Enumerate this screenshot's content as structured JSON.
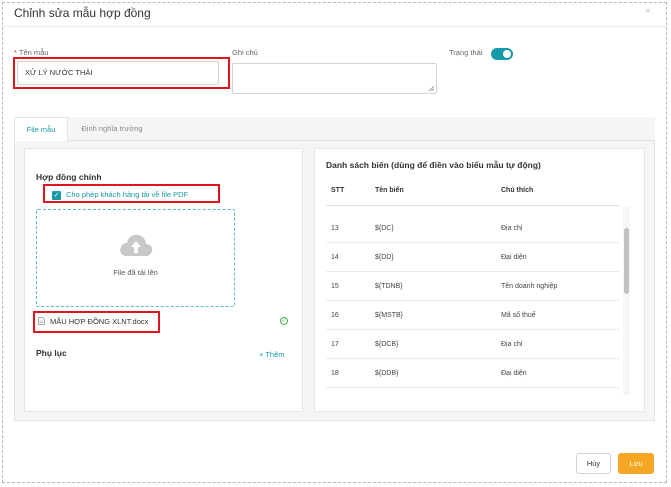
{
  "dialog": {
    "title": "Chỉnh sửa mẫu hợp đồng",
    "close_glyph": "×"
  },
  "form": {
    "name_label": "Tên mẫu",
    "name_required_mark": "*",
    "name_value": "XỬ LÝ NƯỚC THẢI",
    "note_label": "Ghi chú",
    "note_value": "",
    "status_label": "Trạng thái",
    "status_on": true
  },
  "tabs": [
    {
      "label": "File mẫu",
      "active": true
    },
    {
      "label": "Định nghĩa trường",
      "active": false
    }
  ],
  "left_panel": {
    "main_contract_title": "Hợp đồng chính",
    "checkbox_label": "Cho phép khách hàng tải về file PDF",
    "checkbox_checked": true,
    "upload_text": "File đã tải lên",
    "file_name": "MẪU HỢP ĐỒNG XLNT.docx",
    "appendix_title": "Phụ lục",
    "add_label": "+ Thêm"
  },
  "right_panel": {
    "title": "Danh sách biến (dùng để điền vào biểu mẫu tự động)",
    "columns": [
      "STT",
      "Tên biến",
      "Chú thích"
    ],
    "rows": [
      {
        "stt": "13",
        "var": "${DC}",
        "note": "Địa chỉ"
      },
      {
        "stt": "14",
        "var": "${DD}",
        "note": "Đại diện"
      },
      {
        "stt": "15",
        "var": "${TDNB}",
        "note": "Tên doanh nghiệp"
      },
      {
        "stt": "16",
        "var": "${MSTB}",
        "note": "Mã số thuế"
      },
      {
        "stt": "17",
        "var": "${DCB}",
        "note": "Địa chỉ"
      },
      {
        "stt": "18",
        "var": "${DDB}",
        "note": "Đại diện"
      }
    ]
  },
  "footer": {
    "cancel_label": "Hủy",
    "save_label": "Lưu"
  },
  "colors": {
    "accent": "#179aa8",
    "highlight": "#e0141e",
    "save": "#f5a623"
  }
}
